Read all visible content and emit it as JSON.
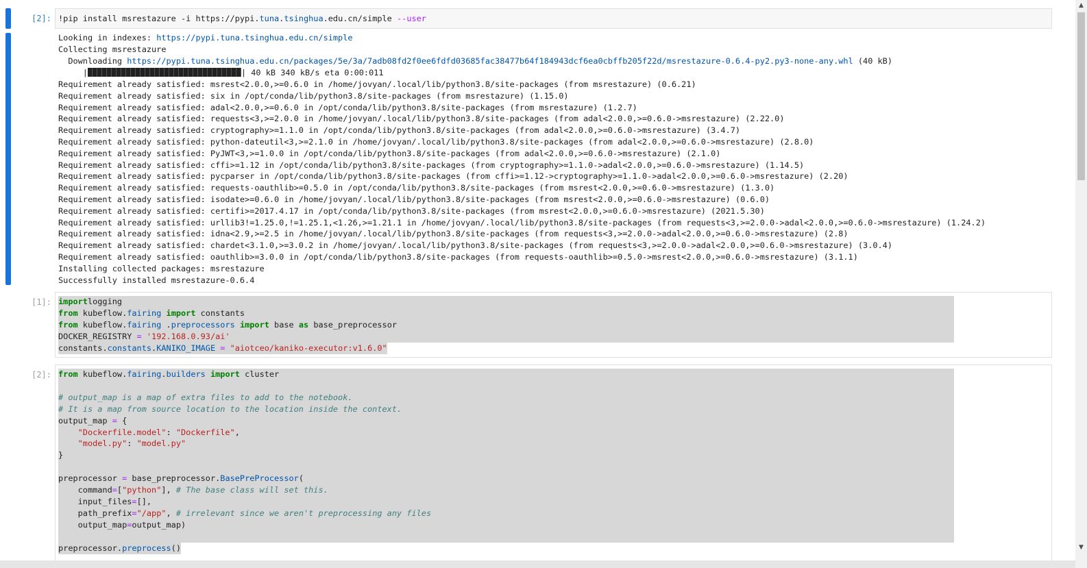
{
  "cell1": {
    "prompt": "[2]:",
    "input_parts": [
      "!pip install msrestazure -i https://pypi.",
      "tuna",
      ".",
      "tsinghua",
      ".edu.cn/simple ",
      "--user"
    ],
    "output": {
      "looking": "Looking in indexes: ",
      "looking_url": "https://pypi.tuna.tsinghua.edu.cn/simple",
      "collecting": "Collecting msrestazure",
      "downloading": "  Downloading ",
      "download_url": "https://pypi.tuna.tsinghua.edu.cn/packages/5e/3a/7adb08fd2f0ee6fdfd03685fac38477b64f184943dcf6ea0cbffb205f22d/msrestazure-0.6.4-py2.py3-none-any.whl",
      "download_size": " (40 kB)",
      "progress_prefix": "     |",
      "progress_fraction": 1.0,
      "progress_suffix": "| 40 kB 340 kB/s eta 0:00:011",
      "requirements": [
        "Requirement already satisfied: msrest<2.0.0,>=0.6.0 in /home/jovyan/.local/lib/python3.8/site-packages (from msrestazure) (0.6.21)",
        "Requirement already satisfied: six in /opt/conda/lib/python3.8/site-packages (from msrestazure) (1.15.0)",
        "Requirement already satisfied: adal<2.0.0,>=0.6.0 in /opt/conda/lib/python3.8/site-packages (from msrestazure) (1.2.7)",
        "Requirement already satisfied: requests<3,>=2.0.0 in /home/jovyan/.local/lib/python3.8/site-packages (from adal<2.0.0,>=0.6.0->msrestazure) (2.22.0)",
        "Requirement already satisfied: cryptography>=1.1.0 in /opt/conda/lib/python3.8/site-packages (from adal<2.0.0,>=0.6.0->msrestazure) (3.4.7)",
        "Requirement already satisfied: python-dateutil<3,>=2.1.0 in /home/jovyan/.local/lib/python3.8/site-packages (from adal<2.0.0,>=0.6.0->msrestazure) (2.8.0)",
        "Requirement already satisfied: PyJWT<3,>=1.0.0 in /opt/conda/lib/python3.8/site-packages (from adal<2.0.0,>=0.6.0->msrestazure) (2.1.0)",
        "Requirement already satisfied: cffi>=1.12 in /opt/conda/lib/python3.8/site-packages (from cryptography>=1.1.0->adal<2.0.0,>=0.6.0->msrestazure) (1.14.5)",
        "Requirement already satisfied: pycparser in /opt/conda/lib/python3.8/site-packages (from cffi>=1.12->cryptography>=1.1.0->adal<2.0.0,>=0.6.0->msrestazure) (2.20)",
        "Requirement already satisfied: requests-oauthlib>=0.5.0 in /opt/conda/lib/python3.8/site-packages (from msrest<2.0.0,>=0.6.0->msrestazure) (1.3.0)",
        "Requirement already satisfied: isodate>=0.6.0 in /home/jovyan/.local/lib/python3.8/site-packages (from msrest<2.0.0,>=0.6.0->msrestazure) (0.6.0)",
        "Requirement already satisfied: certifi>=2017.4.17 in /opt/conda/lib/python3.8/site-packages (from msrest<2.0.0,>=0.6.0->msrestazure) (2021.5.30)",
        "Requirement already satisfied: urllib3!=1.25.0,!=1.25.1,<1.26,>=1.21.1 in /home/jovyan/.local/lib/python3.8/site-packages (from requests<3,>=2.0.0->adal<2.0.0,>=0.6.0->msrestazure) (1.24.2)",
        "Requirement already satisfied: idna<2.9,>=2.5 in /home/jovyan/.local/lib/python3.8/site-packages (from requests<3,>=2.0.0->adal<2.0.0,>=0.6.0->msrestazure) (2.8)",
        "Requirement already satisfied: chardet<3.1.0,>=3.0.2 in /home/jovyan/.local/lib/python3.8/site-packages (from requests<3,>=2.0.0->adal<2.0.0,>=0.6.0->msrestazure) (3.0.4)",
        "Requirement already satisfied: oauthlib>=3.0.0 in /opt/conda/lib/python3.8/site-packages (from requests-oauthlib>=0.5.0->msrest<2.0.0,>=0.6.0->msrestazure) (3.1.1)"
      ],
      "installing": "Installing collected packages: msrestazure",
      "success": "Successfully installed msrestazure-0.6.4"
    }
  },
  "cell2": {
    "prompt": "[1]:",
    "lines": [
      [
        [
          "kw",
          "import"
        ],
        [
          "",
          "logging"
        ]
      ],
      [
        [
          "kw",
          "from"
        ],
        [
          "",
          " kubeflow."
        ],
        [
          "mod",
          "fairing"
        ],
        [
          "",
          " "
        ],
        [
          "kw",
          "import"
        ],
        [
          "",
          " constants"
        ]
      ],
      [
        [
          "kw",
          "from"
        ],
        [
          "",
          " kubeflow."
        ],
        [
          "mod",
          "fairing"
        ],
        [
          "",
          " ."
        ],
        [
          "mod",
          "preprocessors"
        ],
        [
          "",
          " "
        ],
        [
          "kw",
          "import"
        ],
        [
          "",
          " base "
        ],
        [
          "kw",
          "as"
        ],
        [
          "",
          " base_preprocessor"
        ]
      ],
      [
        [
          "",
          "DOCKER_REGISTRY "
        ],
        [
          "op",
          "="
        ],
        [
          "",
          " "
        ],
        [
          "str",
          "'192.168.0.93/ai'"
        ]
      ],
      [
        [
          "",
          "constants"
        ],
        [
          "",
          "."
        ],
        [
          "mod",
          "constants"
        ],
        [
          "",
          "."
        ],
        [
          "mod",
          "KANIKO_IMAGE"
        ],
        [
          "",
          " "
        ],
        [
          "op",
          "="
        ],
        [
          "",
          " "
        ],
        [
          "str",
          "\"aiotceo/kaniko-executor:v1.6.0\""
        ]
      ]
    ]
  },
  "cell3": {
    "prompt": "[2]:",
    "lines": [
      [
        [
          "kw",
          "from"
        ],
        [
          "",
          " kubeflow."
        ],
        [
          "mod",
          "fairing"
        ],
        [
          "",
          "."
        ],
        [
          "mod",
          "builders"
        ],
        [
          "",
          " "
        ],
        [
          "kw",
          "import"
        ],
        [
          "",
          " cluster"
        ]
      ],
      [],
      [
        [
          "com",
          "# output_map is a map of extra files to add to the notebook."
        ]
      ],
      [
        [
          "com",
          "# It is a map from source location to the location inside the context."
        ]
      ],
      [
        [
          "",
          "output_map "
        ],
        [
          "op",
          "="
        ],
        [
          "",
          " {"
        ]
      ],
      [
        [
          "",
          "    "
        ],
        [
          "str",
          "\"Dockerfile.model\""
        ],
        [
          "",
          ": "
        ],
        [
          "str",
          "\"Dockerfile\""
        ],
        [
          "",
          ","
        ]
      ],
      [
        [
          "",
          "    "
        ],
        [
          "str",
          "\"model.py\""
        ],
        [
          "",
          ": "
        ],
        [
          "str",
          "\"model.py\""
        ]
      ],
      [
        [
          "",
          "}"
        ]
      ],
      [],
      [
        [
          "",
          "preprocessor "
        ],
        [
          "op",
          "="
        ],
        [
          "",
          " base_preprocessor."
        ],
        [
          "mod",
          "BasePreProcessor"
        ],
        [
          "",
          "("
        ]
      ],
      [
        [
          "",
          "    command"
        ],
        [
          "op",
          "="
        ],
        [
          "",
          "["
        ],
        [
          "str",
          "\"python\""
        ],
        [
          "",
          "], "
        ],
        [
          "com",
          "# The base class will set this."
        ]
      ],
      [
        [
          "",
          "    input_files"
        ],
        [
          "op",
          "="
        ],
        [
          "",
          "[],"
        ]
      ],
      [
        [
          "",
          "    path_prefix"
        ],
        [
          "op",
          "="
        ],
        [
          "str",
          "\"/app\""
        ],
        [
          "",
          ", "
        ],
        [
          "com",
          "# irrelevant since we aren't preprocessing any files"
        ]
      ],
      [
        [
          "",
          "    output_map"
        ],
        [
          "op",
          "="
        ],
        [
          "",
          "output_map)"
        ]
      ],
      [],
      [
        [
          "",
          "preprocessor."
        ],
        [
          "mod",
          "preprocess"
        ],
        [
          "",
          "()"
        ]
      ]
    ]
  },
  "scrollbar": {
    "up": "▲",
    "down": "▼"
  }
}
